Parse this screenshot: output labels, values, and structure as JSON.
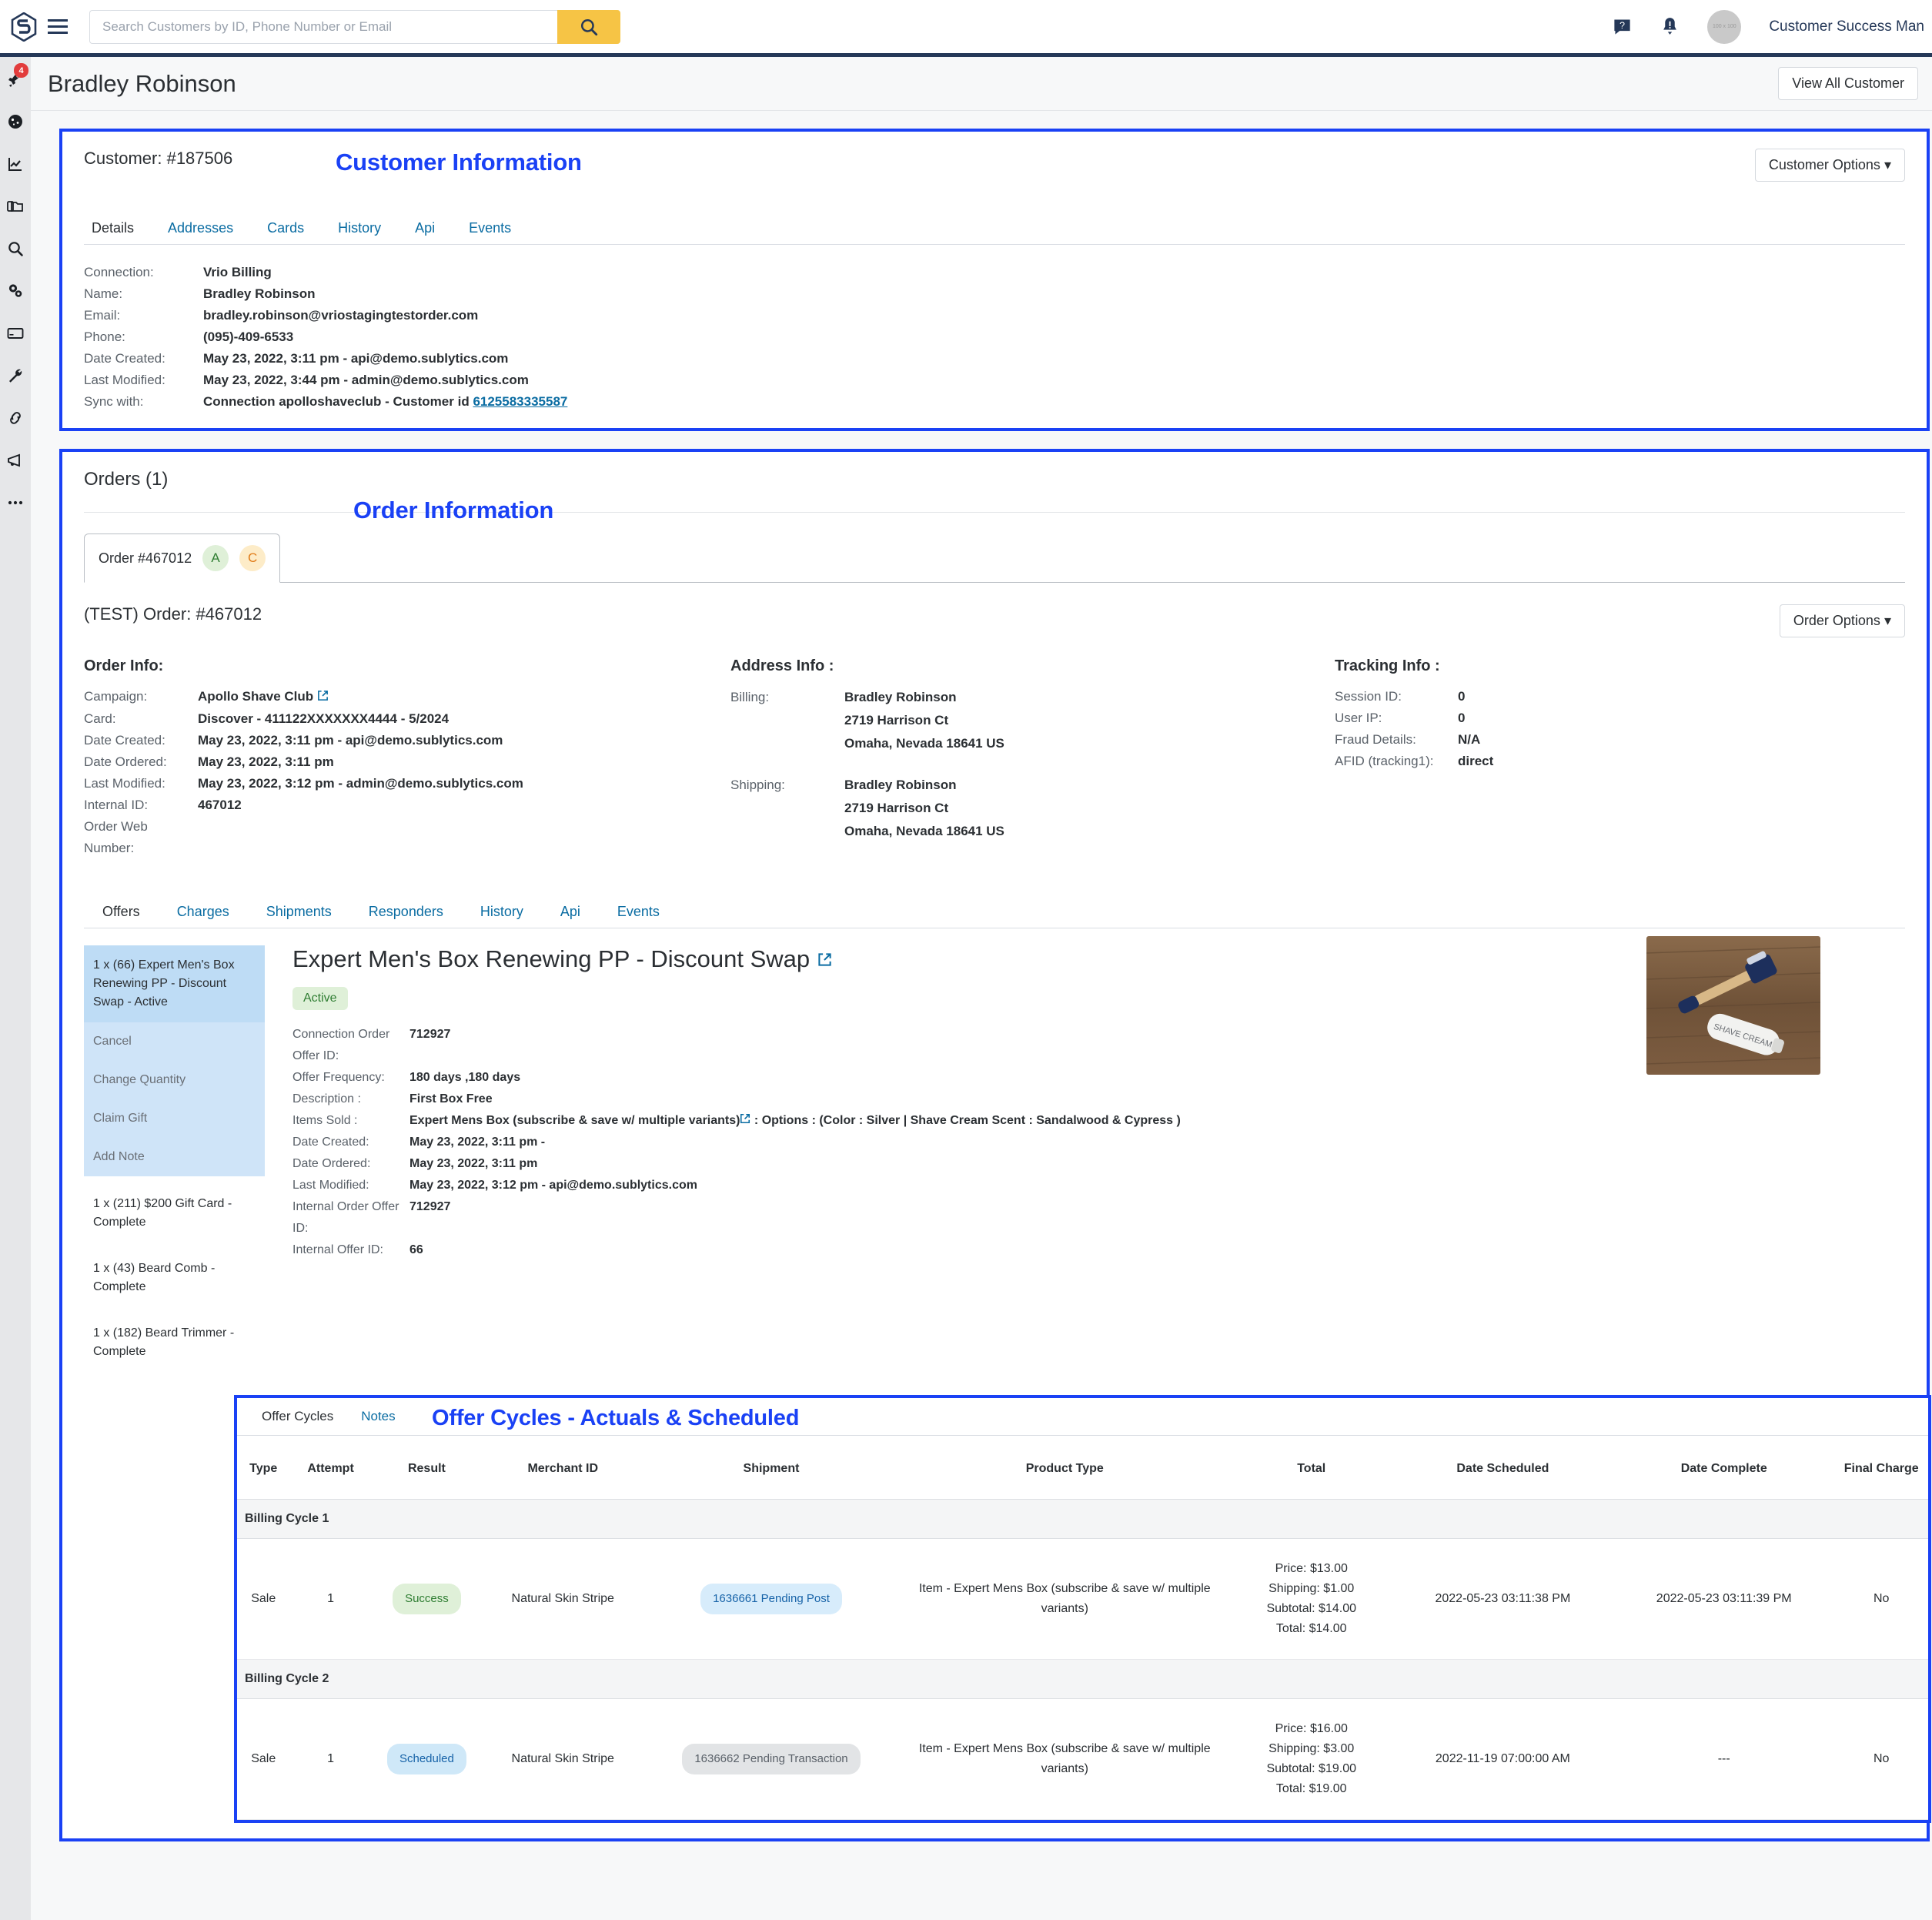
{
  "topbar": {
    "logo_icon": "sublytics-logo-icon",
    "menu_icon": "hamburger-menu-icon",
    "search_placeholder": "Search Customers by ID, Phone Number or Email",
    "search_value": "",
    "search_icon": "search-icon",
    "help_icon": "help-chat-icon",
    "alerts_icon": "alert-bell-icon",
    "avatar_text": "100 x 100",
    "user_name": "Customer Success Man"
  },
  "rail": {
    "items": [
      {
        "icon": "rocket-icon",
        "badge": "4"
      },
      {
        "icon": "dashboard-gauge-icon",
        "badge": ""
      },
      {
        "icon": "analytics-chart-icon",
        "badge": ""
      },
      {
        "icon": "folders-icon",
        "badge": ""
      },
      {
        "icon": "search-icon",
        "badge": ""
      },
      {
        "icon": "gears-settings-icon",
        "badge": ""
      },
      {
        "icon": "credit-card-icon",
        "badge": ""
      },
      {
        "icon": "wrench-tools-icon",
        "badge": ""
      },
      {
        "icon": "link-chain-icon",
        "badge": ""
      },
      {
        "icon": "megaphone-icon",
        "badge": ""
      },
      {
        "icon": "ellipsis-more-icon",
        "badge": ""
      }
    ]
  },
  "page": {
    "title": "Bradley Robinson",
    "view_all_customers": "View All Customer"
  },
  "customer": {
    "overlay_label": "Customer Information",
    "id_label": "Customer: #187506",
    "options_button": "Customer Options",
    "tabs": [
      {
        "label": "Details",
        "active": true
      },
      {
        "label": "Addresses",
        "active": false
      },
      {
        "label": "Cards",
        "active": false
      },
      {
        "label": "History",
        "active": false
      },
      {
        "label": "Api",
        "active": false
      },
      {
        "label": "Events",
        "active": false
      }
    ],
    "details": [
      {
        "key": "Connection:",
        "value": "Vrio Billing"
      },
      {
        "key": "Name:",
        "value": "Bradley Robinson"
      },
      {
        "key": "Email:",
        "value": "bradley.robinson@vriostagingtestorder.com"
      },
      {
        "key": "Phone:",
        "value": "(095)-409-6533"
      },
      {
        "key": "Date Created:",
        "value": "May 23, 2022, 3:11 pm - api@demo.sublytics.com"
      },
      {
        "key": "Last Modified:",
        "value": "May 23, 2022, 3:44 pm - admin@demo.sublytics.com"
      }
    ],
    "sync_key": "Sync with:",
    "sync_text": "Connection apolloshaveclub - Customer id ",
    "sync_link": "6125583335587"
  },
  "orders": {
    "overlay_label": "Order Information",
    "heading": "Orders (1)",
    "tab_label": "Order #467012",
    "tab_badge_a": "A",
    "tab_badge_c": "C",
    "order_heading": "(TEST) Order: #467012",
    "options_button": "Order Options",
    "order_info": {
      "title": "Order Info:",
      "rows": [
        {
          "key": "Campaign:",
          "value": "Apollo Shave Club",
          "link_icon": "external-link-icon"
        },
        {
          "key": "Card:",
          "value": "Discover - 411122XXXXXXX4444 - 5/2024",
          "link_icon": ""
        },
        {
          "key": "Date Created:",
          "value": "May 23, 2022, 3:11 pm - api@demo.sublytics.com",
          "link_icon": ""
        },
        {
          "key": "Date Ordered:",
          "value": "May 23, 2022, 3:11 pm",
          "link_icon": ""
        },
        {
          "key": "Last Modified:",
          "value": "May 23, 2022, 3:12 pm - admin@demo.sublytics.com",
          "link_icon": ""
        },
        {
          "key": "Internal ID:",
          "value": "467012",
          "link_icon": ""
        },
        {
          "key": "Order Web Number:",
          "value": "",
          "link_icon": ""
        }
      ]
    },
    "address_info": {
      "title": "Address Info :",
      "billing_label": "Billing:",
      "billing": [
        "Bradley Robinson",
        "2719 Harrison Ct",
        "Omaha, Nevada 18641 US"
      ],
      "shipping_label": "Shipping:",
      "shipping": [
        "Bradley Robinson",
        "2719 Harrison Ct",
        "Omaha, Nevada 18641 US"
      ]
    },
    "tracking_info": {
      "title": "Tracking Info :",
      "rows": [
        {
          "key": "Session ID:",
          "value": "0"
        },
        {
          "key": "User IP:",
          "value": "0"
        },
        {
          "key": "Fraud Details:",
          "value": "N/A"
        },
        {
          "key": "AFID (tracking1):",
          "value": "direct"
        }
      ]
    },
    "sub_tabs": [
      {
        "label": "Offers",
        "active": true
      },
      {
        "label": "Charges",
        "active": false
      },
      {
        "label": "Shipments",
        "active": false
      },
      {
        "label": "Responders",
        "active": false
      },
      {
        "label": "History",
        "active": false
      },
      {
        "label": "Api",
        "active": false
      },
      {
        "label": "Events",
        "active": false
      }
    ]
  },
  "offers": {
    "selected_item": "1 x (66) Expert Men's Box Renewing PP - Discount Swap - Active",
    "actions": [
      "Cancel",
      "Change Quantity",
      "Claim Gift",
      "Add Note"
    ],
    "other_items": [
      "1 x (211) $200 Gift Card - Complete",
      "1 x (43) Beard Comb - Complete",
      "1 x (182) Beard Trimmer - Complete"
    ],
    "detail": {
      "title": "Expert Men's Box Renewing PP - Discount Swap",
      "title_link_icon": "external-link-icon",
      "status_badge": "Active",
      "rows": [
        {
          "key": "Connection Order Offer ID:",
          "value": "712927"
        },
        {
          "key": "Offer Frequency:",
          "value": "180 days ,180 days"
        },
        {
          "key": "Description :",
          "value": "First Box Free"
        }
      ],
      "items_sold_key": "Items Sold :",
      "items_sold_main": "Expert Mens Box (subscribe & save w/ multiple variants)",
      "items_sold_rest": " : Options : (Color : Silver | Shave Cream Scent : Sandalwood & Cypress )",
      "rows2": [
        {
          "key": "Date Created:",
          "value": "May 23, 2022, 3:11 pm -"
        },
        {
          "key": "Date Ordered:",
          "value": "May 23, 2022, 3:11 pm"
        },
        {
          "key": "Last Modified:",
          "value": "May 23, 2022, 3:12 pm - api@demo.sublytics.com"
        },
        {
          "key": "Internal Order Offer ID:",
          "value": "712927"
        },
        {
          "key": "Internal Offer ID:",
          "value": "66"
        }
      ],
      "product_image_alt": "razor-and-shave-cream-photo"
    }
  },
  "cycles": {
    "overlay_label": "Offer Cycles - Actuals & Scheduled",
    "tabs": [
      {
        "label": "Offer Cycles",
        "active": true
      },
      {
        "label": "Notes",
        "active": false
      }
    ],
    "columns": [
      "Type",
      "Attempt",
      "Result",
      "Merchant ID",
      "Shipment",
      "Product Type",
      "Total",
      "Date Scheduled",
      "Date Complete",
      "Final Charge"
    ],
    "groups": [
      {
        "group_label": "Billing Cycle 1",
        "rows": [
          {
            "type": "Sale",
            "attempt": "1",
            "result": "Success",
            "result_style": "success",
            "merchant_id": "Natural Skin Stripe",
            "shipment": "1636661 Pending Post",
            "shipment_style": "blue",
            "product_type": "Item - Expert Mens Box (subscribe & save w/ multiple variants)",
            "total": "Price: $13.00 Shipping: $1.00 Subtotal: $14.00 Total: $14.00",
            "total_lines": [
              "Price: $13.00",
              "Shipping: $1.00",
              "Subtotal: $14.00",
              "Total: $14.00"
            ],
            "date_scheduled": "2022-05-23 03:11:38 PM",
            "date_complete": "2022-05-23 03:11:39 PM",
            "final_charge": "No"
          }
        ]
      },
      {
        "group_label": "Billing Cycle 2",
        "rows": [
          {
            "type": "Sale",
            "attempt": "1",
            "result": "Scheduled",
            "result_style": "scheduled",
            "merchant_id": "Natural Skin Stripe",
            "shipment": "1636662 Pending Transaction",
            "shipment_style": "grey",
            "product_type": "Item - Expert Mens Box (subscribe & save w/ multiple variants)",
            "total": "Price: $16.00 Shipping: $3.00 Subtotal: $19.00 Total: $19.00",
            "total_lines": [
              "Price: $16.00",
              "Shipping: $3.00",
              "Subtotal: $19.00",
              "Total: $19.00"
            ],
            "date_scheduled": "2022-11-19 07:00:00 AM",
            "date_complete": "---",
            "final_charge": "No"
          }
        ]
      }
    ]
  },
  "colors": {
    "accent_blue": "#1a41f5",
    "link": "#0a6ca2",
    "navy": "#253858",
    "yellow": "#f6c445",
    "success_bg": "#dff0d8",
    "success_fg": "#2f7d32",
    "scheduled_bg": "#cfe8f8",
    "scheduled_fg": "#1763a8"
  }
}
